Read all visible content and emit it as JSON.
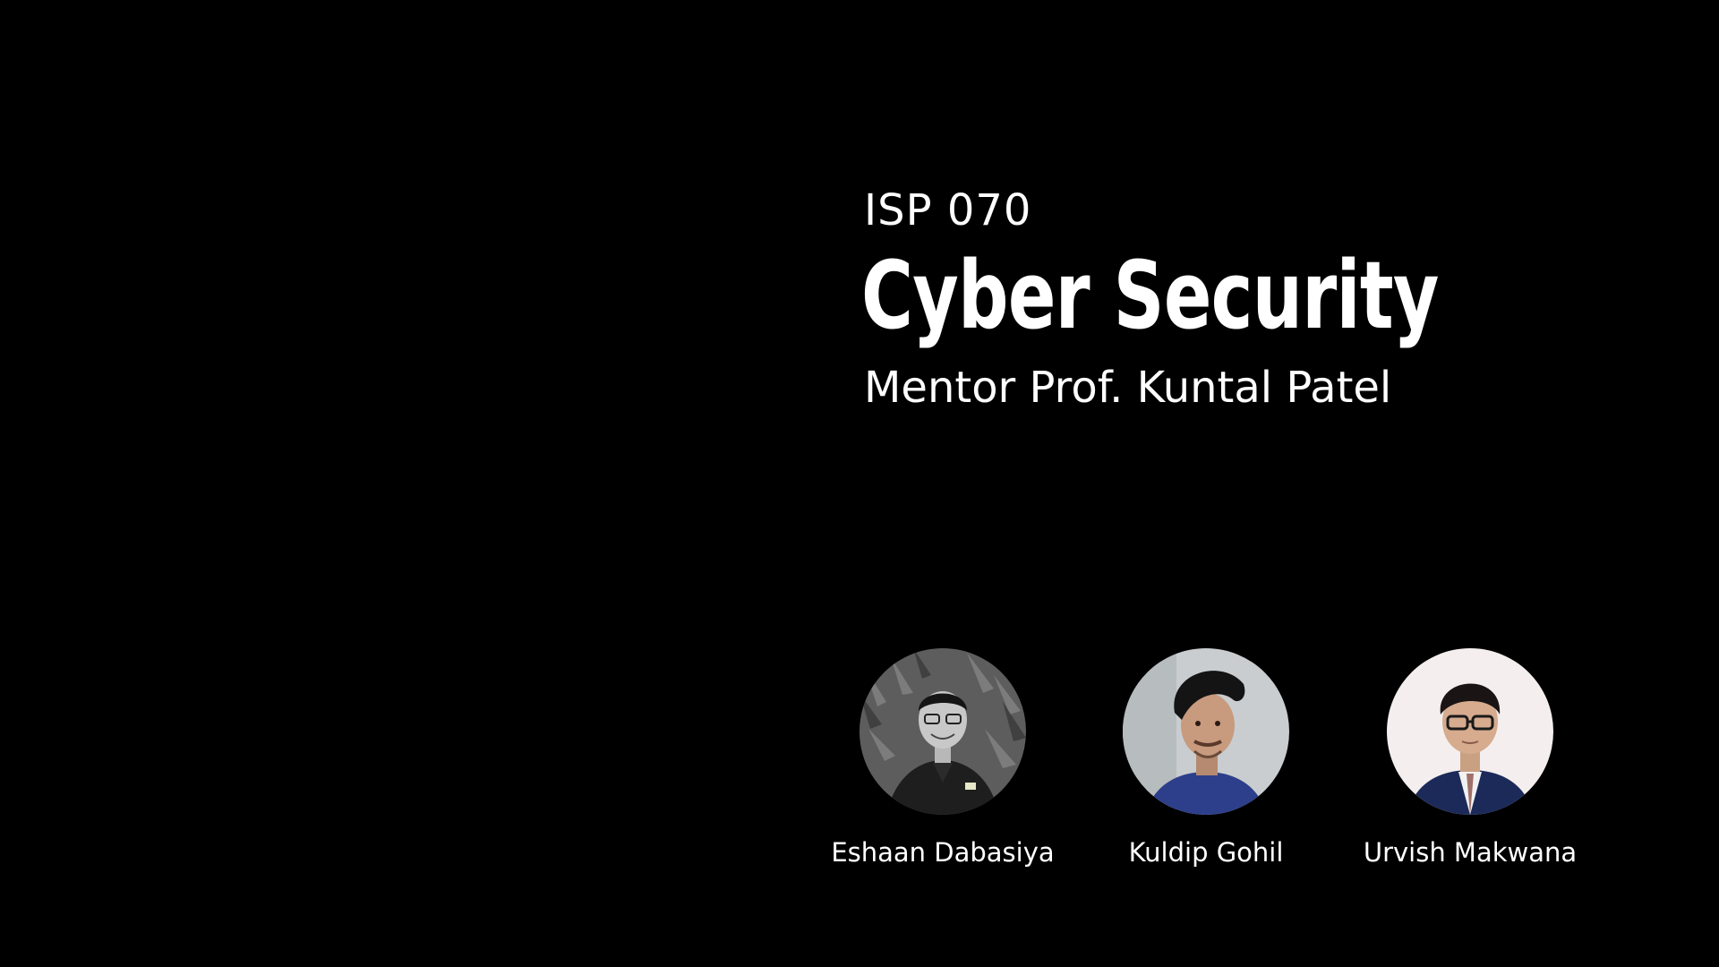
{
  "slide": {
    "code": "ISP 070",
    "title": "Cyber Security",
    "mentor": "Mentor Prof. Kuntal Patel"
  },
  "team": [
    {
      "name": "Eshaan Dabasiya",
      "photo": "avatar-photo-grayscale-suit"
    },
    {
      "name": "Kuldip Gohil",
      "photo": "avatar-photo-blue-tshirt"
    },
    {
      "name": "Urvish Makwana",
      "photo": "avatar-photo-navy-suit-glasses"
    }
  ],
  "colors": {
    "background": "#000000",
    "text": "#ffffff"
  }
}
